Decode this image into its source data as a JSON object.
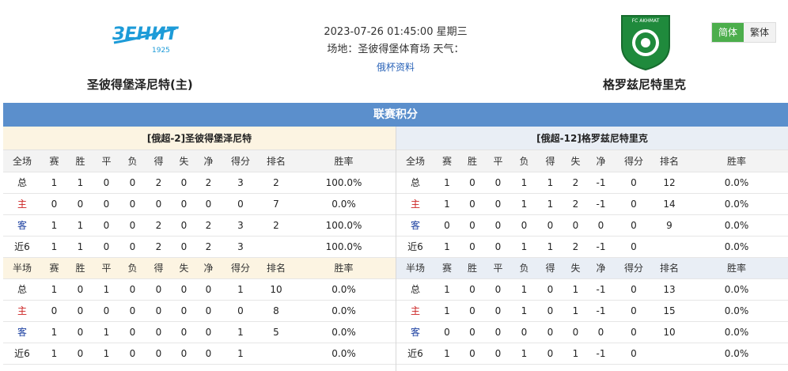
{
  "match": {
    "datetime": "2023-07-26 01:45:00 星期三",
    "venue_line": "场地：圣彼得堡体育场 天气：",
    "cup_link": "俄杯资料"
  },
  "home_team": {
    "name": "圣彼得堡泽尼特(主)",
    "logo_text": "ЗЕНИТ",
    "logo_year": "1925"
  },
  "away_team": {
    "name": "格罗兹尼特里克",
    "logo_text": "FC AKHMAT"
  },
  "lang": {
    "simplified": "简体",
    "traditional": "繁体"
  },
  "section_title": "联赛积分",
  "left": {
    "title": "[俄超-2]圣彼得堡泽尼特",
    "full_header": [
      "全场",
      "赛",
      "胜",
      "平",
      "负",
      "得",
      "失",
      "净",
      "得分",
      "排名",
      "胜率"
    ],
    "full_rows": [
      [
        "总",
        "1",
        "1",
        "0",
        "0",
        "2",
        "0",
        "2",
        "3",
        "2",
        "100.0%"
      ],
      [
        "主",
        "0",
        "0",
        "0",
        "0",
        "0",
        "0",
        "0",
        "0",
        "7",
        "0.0%"
      ],
      [
        "客",
        "1",
        "1",
        "0",
        "0",
        "2",
        "0",
        "2",
        "3",
        "2",
        "100.0%"
      ],
      [
        "近6",
        "1",
        "1",
        "0",
        "0",
        "2",
        "0",
        "2",
        "3",
        "",
        "100.0%"
      ]
    ],
    "half_header": [
      "半场",
      "赛",
      "胜",
      "平",
      "负",
      "得",
      "失",
      "净",
      "得分",
      "排名",
      "胜率"
    ],
    "half_rows": [
      [
        "总",
        "1",
        "0",
        "1",
        "0",
        "0",
        "0",
        "0",
        "1",
        "10",
        "0.0%"
      ],
      [
        "主",
        "0",
        "0",
        "0",
        "0",
        "0",
        "0",
        "0",
        "0",
        "8",
        "0.0%"
      ],
      [
        "客",
        "1",
        "0",
        "1",
        "0",
        "0",
        "0",
        "0",
        "1",
        "5",
        "0.0%"
      ],
      [
        "近6",
        "1",
        "0",
        "1",
        "0",
        "0",
        "0",
        "0",
        "1",
        "",
        "0.0%"
      ]
    ]
  },
  "right": {
    "title": "[俄超-12]格罗兹尼特里克",
    "full_header": [
      "全场",
      "赛",
      "胜",
      "平",
      "负",
      "得",
      "失",
      "净",
      "得分",
      "排名",
      "胜率"
    ],
    "full_rows": [
      [
        "总",
        "1",
        "0",
        "0",
        "1",
        "1",
        "2",
        "-1",
        "0",
        "12",
        "0.0%"
      ],
      [
        "主",
        "1",
        "0",
        "0",
        "1",
        "1",
        "2",
        "-1",
        "0",
        "14",
        "0.0%"
      ],
      [
        "客",
        "0",
        "0",
        "0",
        "0",
        "0",
        "0",
        "0",
        "0",
        "9",
        "0.0%"
      ],
      [
        "近6",
        "1",
        "0",
        "0",
        "1",
        "1",
        "2",
        "-1",
        "0",
        "",
        "0.0%"
      ]
    ],
    "half_header": [
      "半场",
      "赛",
      "胜",
      "平",
      "负",
      "得",
      "失",
      "净",
      "得分",
      "排名",
      "胜率"
    ],
    "half_rows": [
      [
        "总",
        "1",
        "0",
        "0",
        "1",
        "0",
        "1",
        "-1",
        "0",
        "13",
        "0.0%"
      ],
      [
        "主",
        "1",
        "0",
        "0",
        "1",
        "0",
        "1",
        "-1",
        "0",
        "15",
        "0.0%"
      ],
      [
        "客",
        "0",
        "0",
        "0",
        "0",
        "0",
        "0",
        "0",
        "0",
        "10",
        "0.0%"
      ],
      [
        "近6",
        "1",
        "0",
        "0",
        "1",
        "0",
        "1",
        "-1",
        "0",
        "",
        "0.0%"
      ]
    ]
  },
  "colors": {
    "title_bar": "#5b8fcc",
    "home_side": "#fcf4e2",
    "away_side": "#e9eef5",
    "lang_active": "#4cae4c",
    "home_label": "#cc2222",
    "away_label": "#1b3fa0"
  }
}
